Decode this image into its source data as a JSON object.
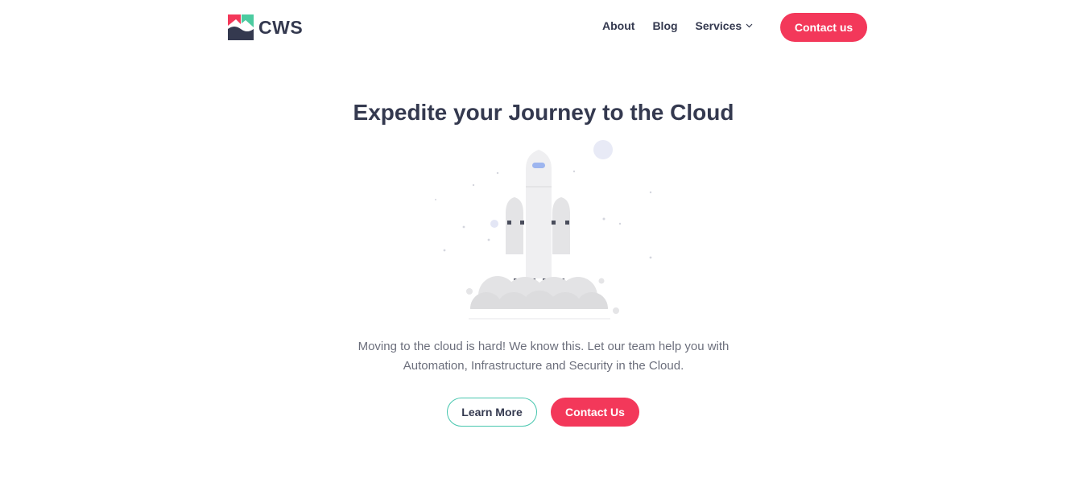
{
  "brand": {
    "name": "CWS",
    "logo_colors": {
      "red": "#f3385a",
      "green": "#4ccba0",
      "navy": "#34394f"
    }
  },
  "nav": {
    "items": [
      {
        "label": "About"
      },
      {
        "label": "Blog"
      },
      {
        "label": "Services",
        "icon": "chevron-down-icon"
      }
    ],
    "cta_label": "Contact us"
  },
  "hero": {
    "title": "Expedite your Journey to the Cloud",
    "illustration": "rocket-launch-illustration",
    "description": "Moving to the cloud is hard! We know this. Let our team help you with Automation, Infrastructure and Security in the Cloud.",
    "primary_button": "Learn More",
    "secondary_button": "Contact Us"
  },
  "colors": {
    "accent": "#f3385a",
    "outline_accent": "#47c6ae",
    "text": "#34394f",
    "muted_text": "#6c6f7c"
  }
}
